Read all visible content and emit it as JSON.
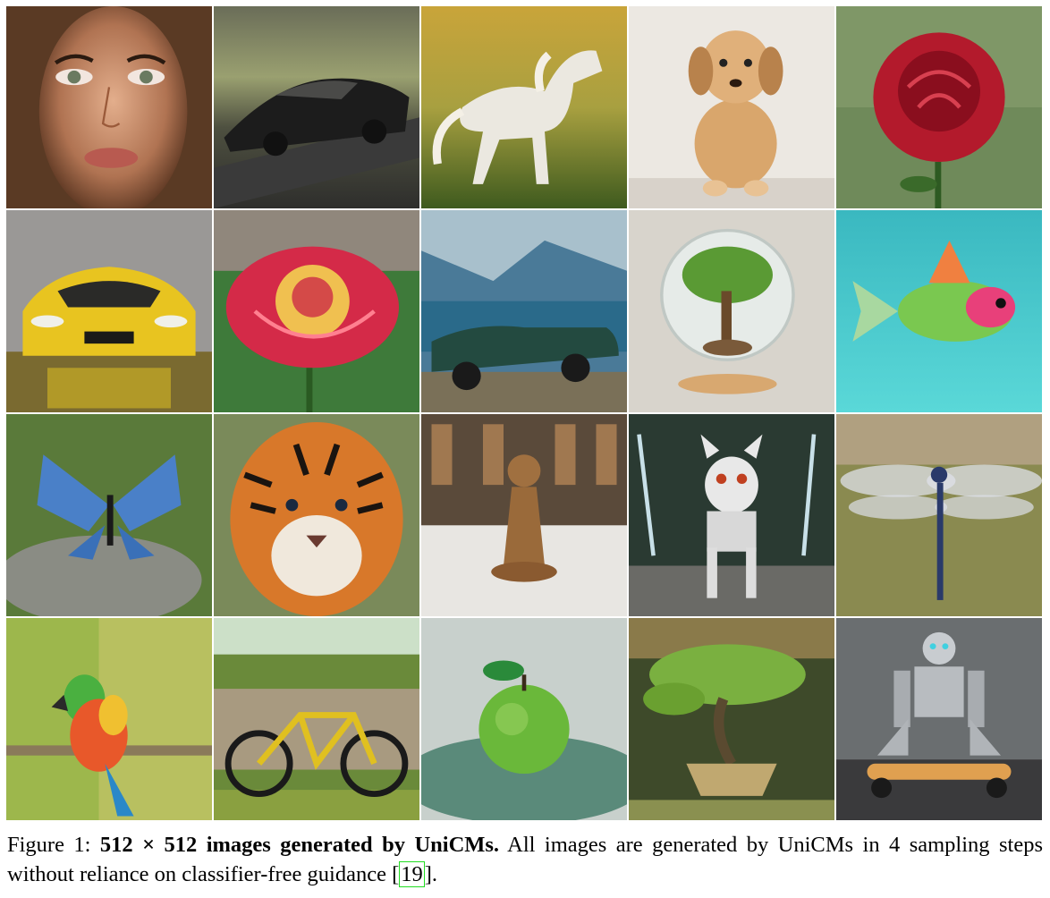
{
  "figure": {
    "label": "Figure 1:",
    "title_bold": "512 × 512 images generated by UniCMs.",
    "body_text": "All images are generated by UniCMs in 4 sampling steps without reliance on classifier-free guidance [",
    "citation": "19",
    "closing": "]."
  }
}
